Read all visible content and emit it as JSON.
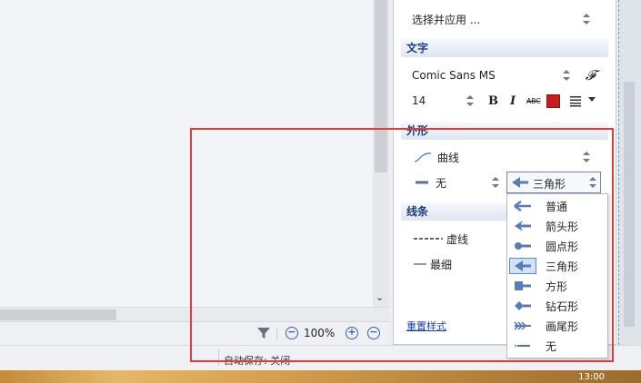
{
  "canvas": {
    "scroll_down_glyph": "⌄"
  },
  "statusbar": {
    "zoom": "100%",
    "zoom_out": "−",
    "zoom_in": "+"
  },
  "bottom": {
    "autosave": "自动保存: 关闭",
    "clock": "13:00"
  },
  "panel": {
    "apply_select": "选择并应用 ...",
    "text_section": "文字",
    "font_name": "Comic Sans MS",
    "font_icon": "𝓕",
    "font_size": "14",
    "bold": "B",
    "italic": "I",
    "strike": "ABC",
    "text_color": "#c41e1e",
    "shape_section": "外形",
    "curve_label": "曲线",
    "line_end_label": "无",
    "arrow_selected": "三角形",
    "line_section": "线条",
    "dash_label": "虚线",
    "weight_label": "最细",
    "reset_link": "重置样式"
  },
  "dropdown": {
    "items": [
      {
        "label": "普通",
        "icon": "arrow-normal-icon"
      },
      {
        "label": "箭头形",
        "icon": "arrow-open-icon"
      },
      {
        "label": "圆点形",
        "icon": "arrow-dot-icon"
      },
      {
        "label": "三角形",
        "icon": "arrow-triangle-icon",
        "selected": true
      },
      {
        "label": "方形",
        "icon": "arrow-square-icon"
      },
      {
        "label": "钻石形",
        "icon": "arrow-diamond-icon"
      },
      {
        "label": "画尾形",
        "icon": "arrow-feather-icon"
      },
      {
        "label": "无",
        "icon": "arrow-none-icon"
      }
    ]
  },
  "colors": {
    "accent": "#1f3d7a",
    "highlight_rect": "#e53a3a",
    "arrow_icon": "#5b7bb6"
  }
}
